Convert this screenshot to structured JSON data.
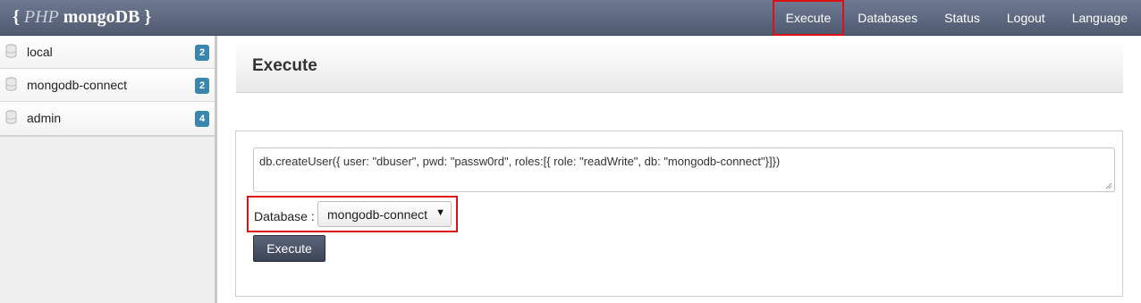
{
  "brand": {
    "open_brace": "{",
    "php": "PHP",
    "name": "mongoDB",
    "close_brace": "}"
  },
  "nav": {
    "items": [
      {
        "label": "Execute",
        "highlighted": true
      },
      {
        "label": "Databases"
      },
      {
        "label": "Status"
      },
      {
        "label": "Logout"
      },
      {
        "label": "Language"
      }
    ]
  },
  "sidebar": {
    "databases": [
      {
        "name": "local",
        "count": "2",
        "icon": "database-icon"
      },
      {
        "name": "mongodb-connect",
        "count": "2",
        "icon": "database-icon"
      },
      {
        "name": "admin",
        "count": "4",
        "icon": "database-icon"
      }
    ],
    "badge_color": "#3a87ad"
  },
  "main": {
    "title": "Execute",
    "code": "db.createUser({ user: \"dbuser\", pwd: \"passw0rd\", roles:[{ role: \"readWrite\", db: \"mongodb-connect\"}]})",
    "database_label": "Database :",
    "database_selected": "mongodb-connect",
    "execute_button": "Execute"
  },
  "colors": {
    "topbar": "#5d687e",
    "highlight": "#dd1111",
    "button": "#4a5367"
  }
}
